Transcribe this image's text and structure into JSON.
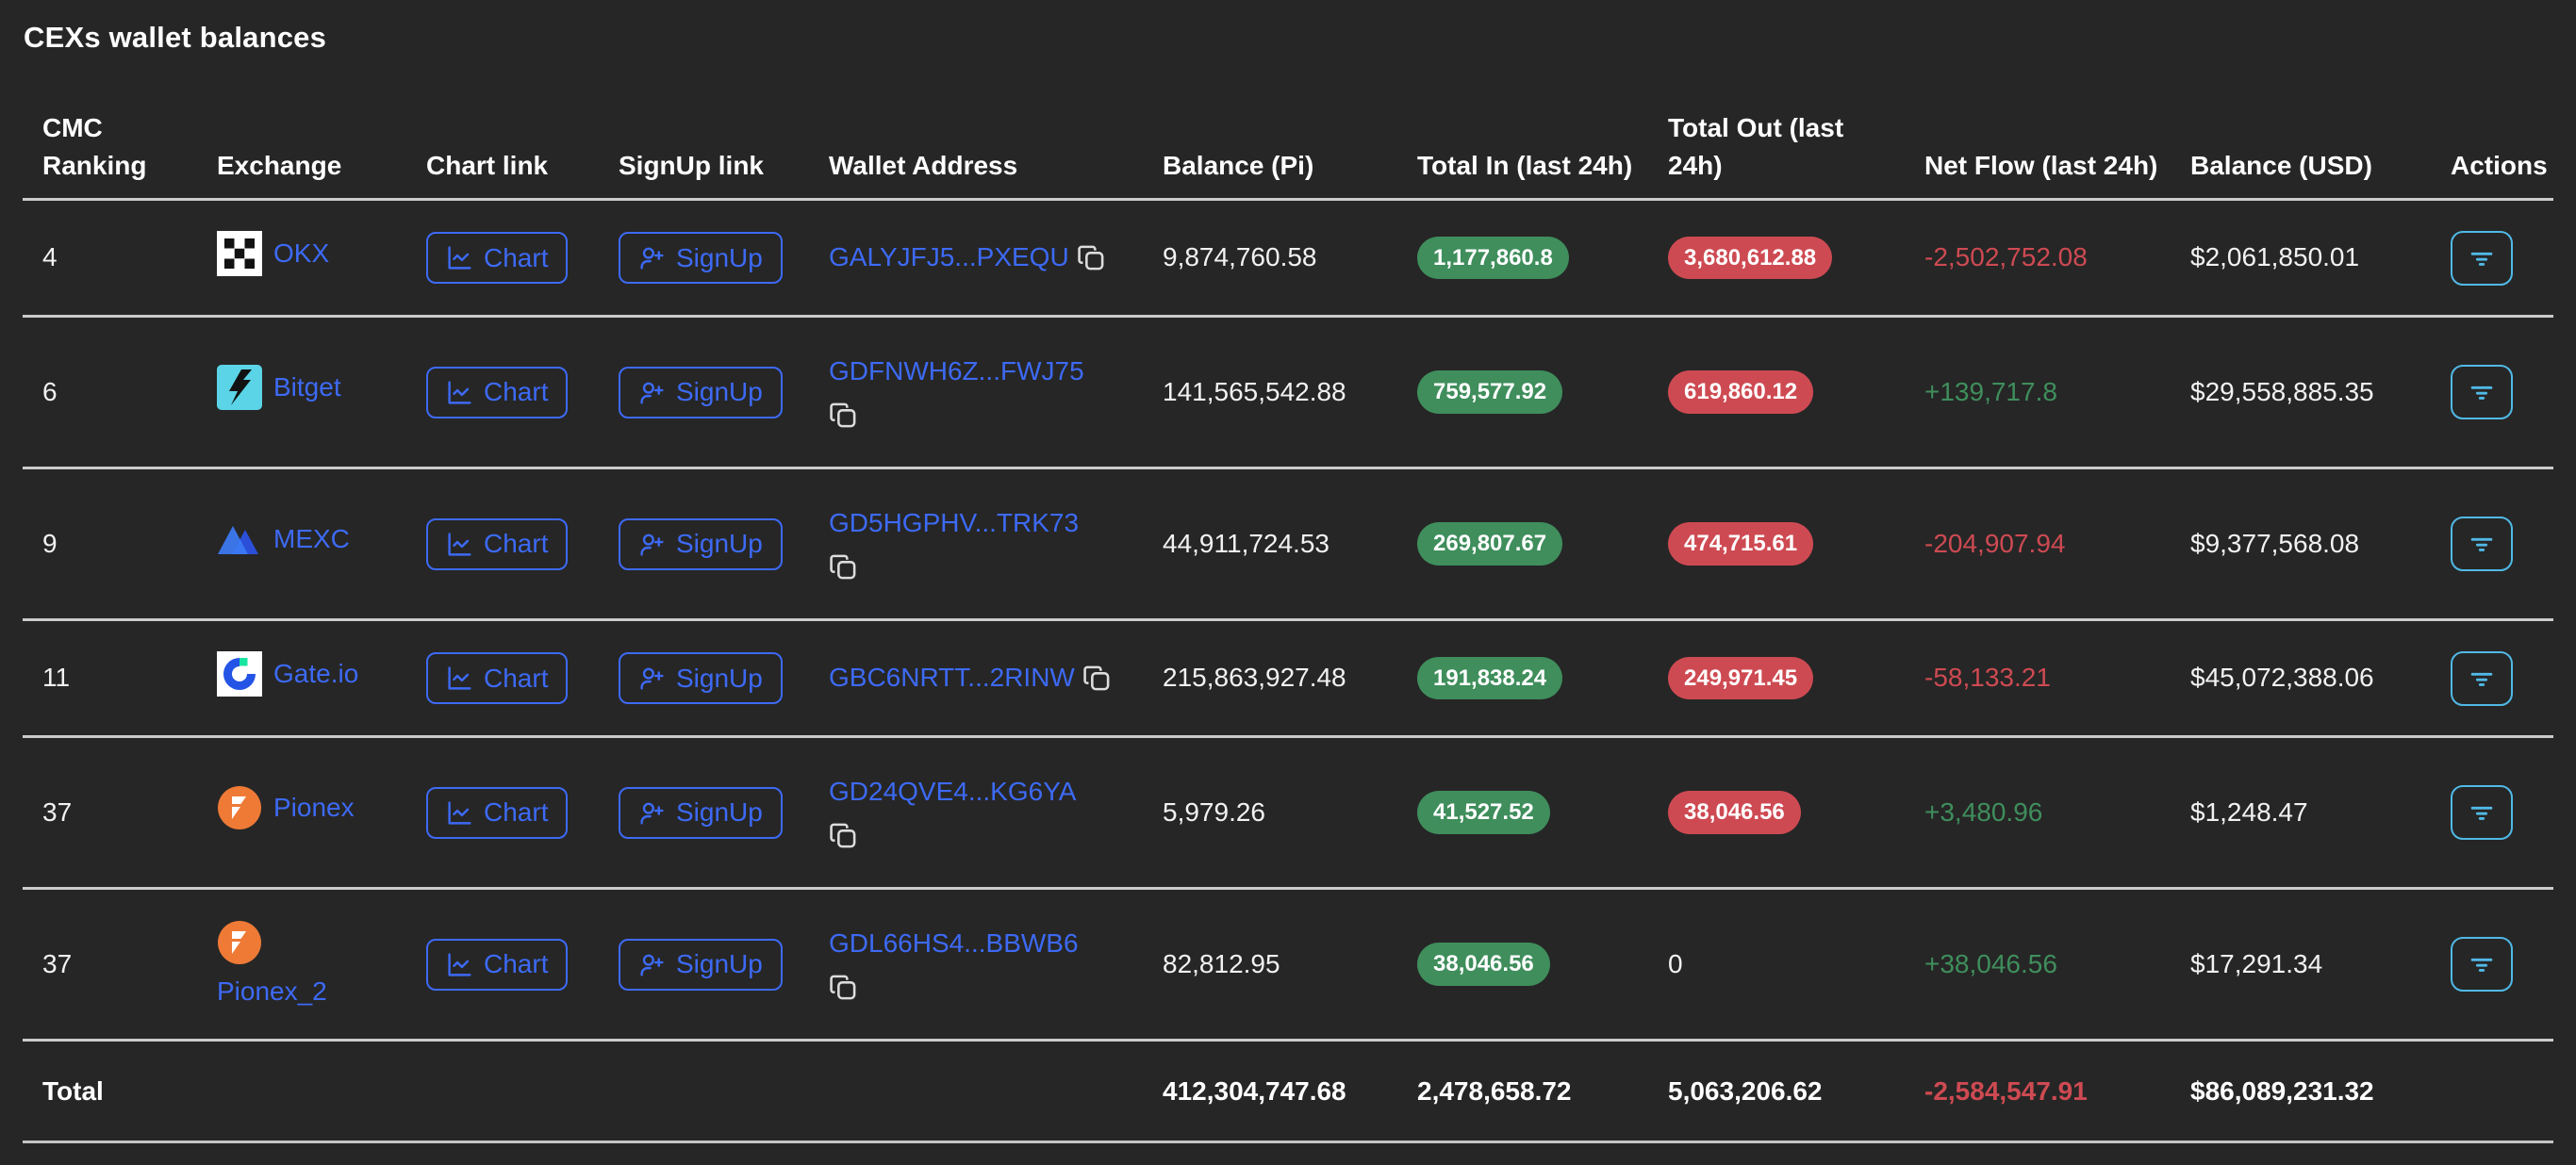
{
  "title": "CEXs wallet balances",
  "colors": {
    "background": "#262626",
    "accent_blue": "#3d6af5",
    "accent_cyan": "#50b9e6",
    "badge_green": "#3f8e5c",
    "badge_red": "#ce4a52",
    "text_green": "#3f8e5c",
    "text_red": "#ce4a52",
    "divider": "#cbcbcb"
  },
  "buttons": {
    "chart_label": "Chart",
    "signup_label": "SignUp"
  },
  "columns": [
    {
      "id": "ranking",
      "label": "CMC Ranking"
    },
    {
      "id": "exchange",
      "label": "Exchange"
    },
    {
      "id": "chart",
      "label": "Chart link"
    },
    {
      "id": "signup",
      "label": "SignUp link"
    },
    {
      "id": "wallet",
      "label": "Wallet Address"
    },
    {
      "id": "balance_pi",
      "label": "Balance (Pi)"
    },
    {
      "id": "total_in",
      "label": "Total In (last 24h)"
    },
    {
      "id": "total_out",
      "label": "Total Out (last 24h)"
    },
    {
      "id": "net_flow",
      "label": "Net Flow (last 24h)"
    },
    {
      "id": "balance_usd",
      "label": "Balance (USD)"
    },
    {
      "id": "actions",
      "label": "Actions"
    }
  ],
  "rows": [
    {
      "ranking": "4",
      "exchange": {
        "id": "okx",
        "name": "OKX",
        "two_line": false
      },
      "wallet": {
        "address": "GALYJFJ5...PXEQU",
        "copy_on_second_line": false
      },
      "balance_pi": "9,874,760.58",
      "total_in": "1,177,860.8",
      "total_out": {
        "text": "3,680,612.88",
        "badge": true
      },
      "net_flow": {
        "text": "-2,502,752.08",
        "direction": "negative"
      },
      "balance_usd": "$2,061,850.01",
      "tall": false
    },
    {
      "ranking": "6",
      "exchange": {
        "id": "bitget",
        "name": "Bitget",
        "two_line": false
      },
      "wallet": {
        "address": "GDFNWH6Z...FWJ75",
        "copy_on_second_line": true
      },
      "balance_pi": "141,565,542.88",
      "total_in": "759,577.92",
      "total_out": {
        "text": "619,860.12",
        "badge": true
      },
      "net_flow": {
        "text": "+139,717.8",
        "direction": "positive"
      },
      "balance_usd": "$29,558,885.35",
      "tall": true
    },
    {
      "ranking": "9",
      "exchange": {
        "id": "mexc",
        "name": "MEXC",
        "two_line": false
      },
      "wallet": {
        "address": "GD5HGPHV...TRK73",
        "copy_on_second_line": true
      },
      "balance_pi": "44,911,724.53",
      "total_in": "269,807.67",
      "total_out": {
        "text": "474,715.61",
        "badge": true
      },
      "net_flow": {
        "text": "-204,907.94",
        "direction": "negative"
      },
      "balance_usd": "$9,377,568.08",
      "tall": true
    },
    {
      "ranking": "11",
      "exchange": {
        "id": "gateio",
        "name": "Gate.io",
        "two_line": false
      },
      "wallet": {
        "address": "GBC6NRTT...2RINW",
        "copy_on_second_line": false
      },
      "balance_pi": "215,863,927.48",
      "total_in": "191,838.24",
      "total_out": {
        "text": "249,971.45",
        "badge": true
      },
      "net_flow": {
        "text": "-58,133.21",
        "direction": "negative"
      },
      "balance_usd": "$45,072,388.06",
      "tall": false
    },
    {
      "ranking": "37",
      "exchange": {
        "id": "pionex",
        "name": "Pionex",
        "two_line": false
      },
      "wallet": {
        "address": "GD24QVE4...KG6YA",
        "copy_on_second_line": true
      },
      "balance_pi": "5,979.26",
      "total_in": "41,527.52",
      "total_out": {
        "text": "38,046.56",
        "badge": true
      },
      "net_flow": {
        "text": "+3,480.96",
        "direction": "positive"
      },
      "balance_usd": "$1,248.47",
      "tall": true
    },
    {
      "ranking": "37",
      "exchange": {
        "id": "pionex",
        "name": "Pionex_2",
        "two_line": true
      },
      "wallet": {
        "address": "GDL66HS4...BBWB6",
        "copy_on_second_line": true
      },
      "balance_pi": "82,812.95",
      "total_in": "38,046.56",
      "total_out": {
        "text": "0",
        "badge": false
      },
      "net_flow": {
        "text": "+38,046.56",
        "direction": "positive"
      },
      "balance_usd": "$17,291.34",
      "tall": true
    }
  ],
  "totals": {
    "label": "Total",
    "balance_pi": "412,304,747.68",
    "total_in": "2,478,658.72",
    "total_out": "5,063,206.62",
    "net_flow": {
      "text": "-2,584,547.91",
      "direction": "negative"
    },
    "balance_usd": "$86,089,231.32"
  }
}
